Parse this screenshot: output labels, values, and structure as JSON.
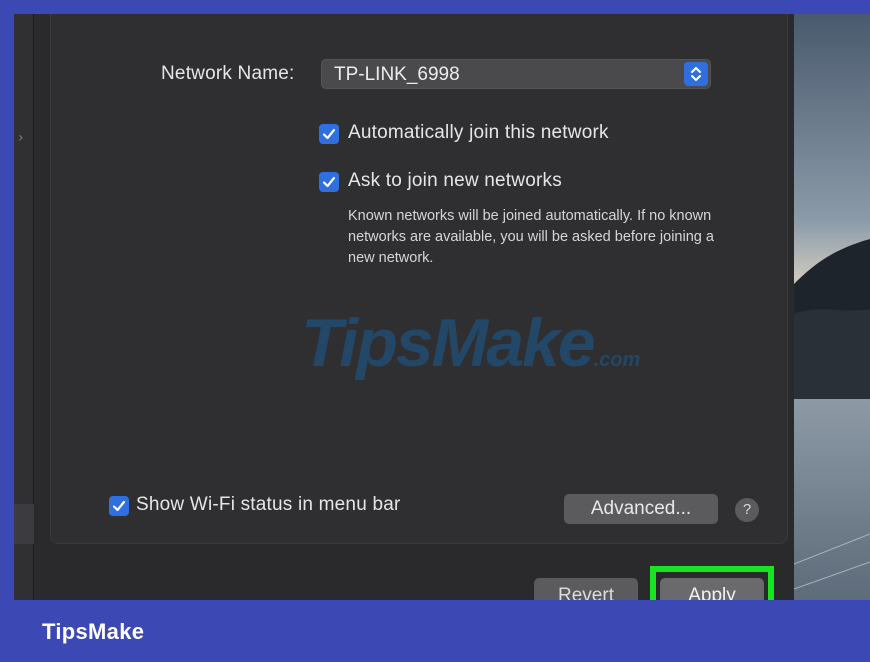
{
  "network": {
    "name_label": "Network Name:",
    "name_value": "TP-LINK_6998"
  },
  "options": {
    "auto_join": {
      "label": "Automatically join this network",
      "checked": true
    },
    "ask_to_join": {
      "label": "Ask to join new networks",
      "checked": true
    },
    "ask_hint": "Known networks will be joined automatically. If no known networks are available, you will be asked before joining a new network.",
    "show_status": {
      "label": "Show Wi-Fi status in menu bar",
      "checked": true
    }
  },
  "buttons": {
    "advanced": "Advanced...",
    "help": "?",
    "revert": "Revert",
    "apply": "Apply"
  },
  "watermark": {
    "main": "TipsMake",
    "suffix": ".com"
  },
  "footer": {
    "brand": "TipsMake"
  },
  "colors": {
    "accent": "#2f6fe0",
    "highlight": "#16e51f",
    "frame": "#3c48b3"
  },
  "icons": {
    "checkbox": "checkmark-icon",
    "stepper": "up-down-chevron-icon",
    "sidebar": "chevron-right-icon"
  }
}
